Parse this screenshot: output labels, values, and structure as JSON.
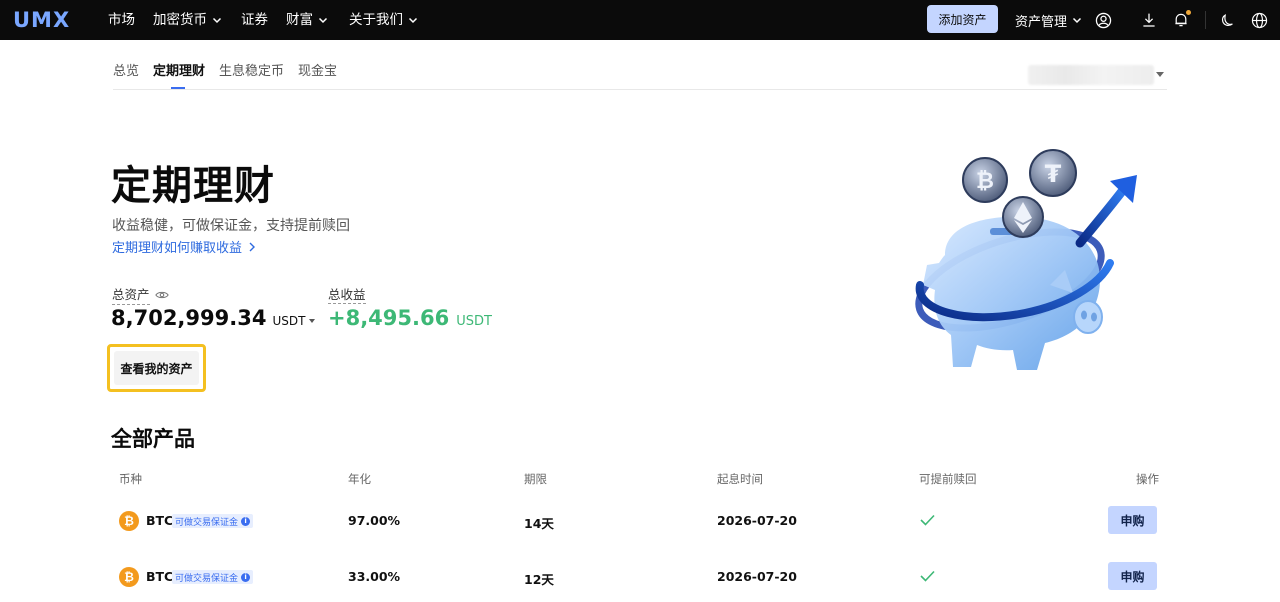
{
  "navbar": {
    "logo": "UMX",
    "items": [
      {
        "label": "市场",
        "has_dropdown": false
      },
      {
        "label": "加密货币",
        "has_dropdown": true
      },
      {
        "label": "证券",
        "has_dropdown": false
      },
      {
        "label": "财富",
        "has_dropdown": true
      },
      {
        "label": "关于我们",
        "has_dropdown": true
      }
    ],
    "add_assets_label": "添加资产",
    "asset_management_label": "资产管理",
    "icons": [
      "user-icon",
      "download-icon",
      "bell-icon",
      "moon-icon",
      "globe-icon"
    ],
    "accent_color": "#c4d5ff"
  },
  "subtabs": {
    "items": [
      "总览",
      "定期理财",
      "生息稳定币",
      "现金宝"
    ],
    "active": "定期理财"
  },
  "hero": {
    "title": "定期理财",
    "subtitle": "收益稳健，可做保证金，支持提前赎回",
    "link": "定期理财如何赚取收益",
    "total_assets_label": "总资产",
    "total_assets_value": "8,702,999.34",
    "total_assets_unit": "USDT",
    "total_income_label": "总收益",
    "total_income_value": "+8,495.66",
    "total_income_unit": "USDT",
    "view_assets_button": "查看我的资产",
    "income_color": "#3db876"
  },
  "products": {
    "title": "全部产品",
    "columns": [
      "币种",
      "年化",
      "期限",
      "起息时间",
      "可提前赎回",
      "操作"
    ],
    "rows": [
      {
        "coin": "BTC",
        "badge": "可做交易保证金",
        "apy": "97.00%",
        "term": "14天",
        "start": "2026-07-20",
        "early_redeem": true,
        "action": "申购"
      },
      {
        "coin": "BTC",
        "badge": "可做交易保证金",
        "apy": "33.00%",
        "term": "12天",
        "start": "2026-07-20",
        "early_redeem": true,
        "action": "申购"
      }
    ]
  }
}
